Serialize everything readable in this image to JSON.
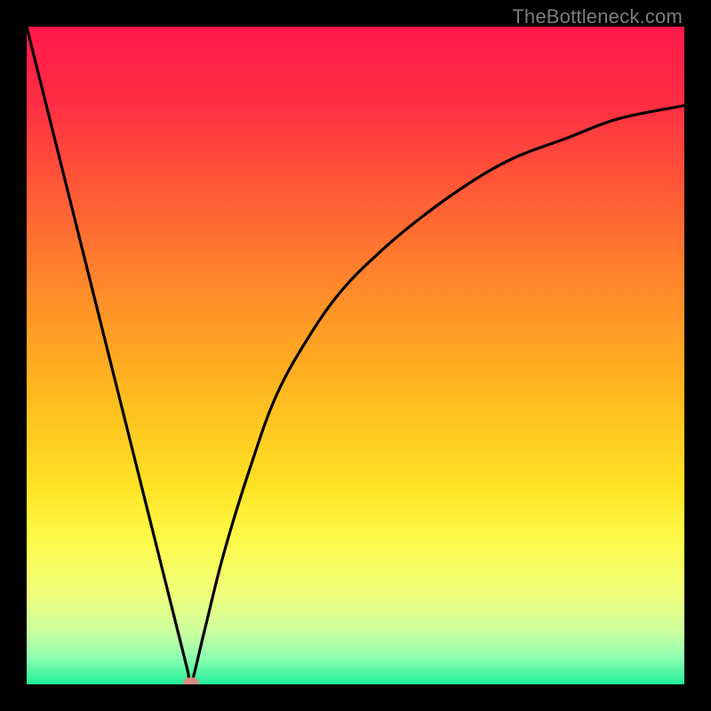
{
  "watermark": "TheBottleneck.com",
  "chart_data": {
    "type": "line",
    "title": "",
    "xlabel": "",
    "ylabel": "",
    "xlim": [
      0,
      100
    ],
    "ylim": [
      0,
      100
    ],
    "grid": false,
    "legend": false,
    "curve_note": "V-shaped bottleneck curve. Minimum near x≈25, y≈0. Left branch from (0,100) to minimum. Right branch rises with decreasing slope toward (100,≈88).",
    "series": [
      {
        "name": "bottleneck-curve",
        "x": [
          0,
          3,
          6,
          9,
          12,
          15,
          18,
          21,
          23,
          24.5,
          25,
          27,
          30,
          34,
          38,
          43,
          48,
          54,
          60,
          67,
          74,
          82,
          90,
          100
        ],
        "y": [
          100,
          88,
          76,
          64,
          52,
          40,
          28,
          16,
          8,
          2,
          0,
          8,
          20,
          33,
          44,
          53,
          60,
          66,
          71,
          76,
          80,
          83,
          86,
          88
        ]
      }
    ],
    "minimum_marker": {
      "x": 25,
      "y": 0,
      "color": "#d88d82"
    },
    "background_gradient": {
      "stops": [
        {
          "offset": 0.0,
          "color": "#ff184a"
        },
        {
          "offset": 0.12,
          "color": "#ff2f43"
        },
        {
          "offset": 0.25,
          "color": "#ff5a36"
        },
        {
          "offset": 0.4,
          "color": "#ff8a2a"
        },
        {
          "offset": 0.55,
          "color": "#ffb71f"
        },
        {
          "offset": 0.7,
          "color": "#ffe324"
        },
        {
          "offset": 0.78,
          "color": "#fdfb4a"
        },
        {
          "offset": 0.86,
          "color": "#f2ff7a"
        },
        {
          "offset": 0.92,
          "color": "#ccffa0"
        },
        {
          "offset": 0.96,
          "color": "#8cffb0"
        },
        {
          "offset": 1.0,
          "color": "#22ee9a"
        }
      ]
    }
  }
}
